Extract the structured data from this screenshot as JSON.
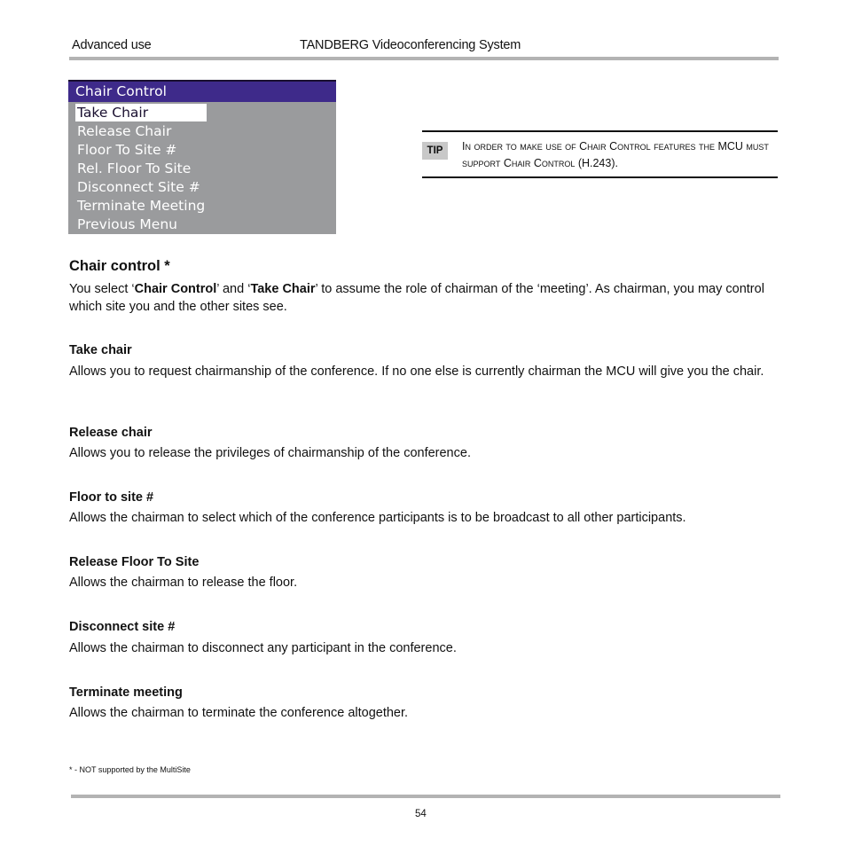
{
  "header": {
    "section": "Advanced use",
    "title": "TANDBERG Videoconferencing System"
  },
  "osd_menu": {
    "title": "Chair Control",
    "selected_index": 0,
    "items": [
      {
        "label": "Take Chair"
      },
      {
        "label": "Release Chair"
      },
      {
        "label": "Floor To Site #"
      },
      {
        "label": "Rel. Floor To Site"
      },
      {
        "label": "Disconnect Site #"
      },
      {
        "label": "Terminate Meeting"
      },
      {
        "label": "Previous Menu"
      }
    ],
    "colors": {
      "title_bg": "#3e2a8a",
      "menu_bg": "#9a9b9d",
      "selected_bg": "#ffffff"
    }
  },
  "tip": {
    "badge": "TIP",
    "text": "In order to make use of Chair Control features the MCU must support Chair Control (H.243)."
  },
  "section": {
    "heading": "Chair control *",
    "intro": {
      "p1": "You select ‘",
      "b1": "Chair Control",
      "p2": "’ and ‘",
      "b2": "Take Chair",
      "p3": "’ to assume the role of chairman of the ‘meeting’. As chairman, you may control which site you and the other sites see."
    },
    "subsections": [
      {
        "heading": "Take  chair",
        "text": "Allows you to request chairmanship of the conference. If no one else is currently chairman the MCU will give you the chair."
      },
      {
        "heading": "Release  chair",
        "text": "Allows you to release the privileges of chairmanship of the conference."
      },
      {
        "heading": "Floor to site #",
        "text": "Allows the chairman to select which of the conference participants is to be broadcast to all other participants."
      },
      {
        "heading": "Release Floor To Site",
        "text": "Allows the chairman to release the floor."
      },
      {
        "heading": "Disconnect site #",
        "text": "Allows the chairman to disconnect any participant in the conference."
      },
      {
        "heading": "Terminate  meeting",
        "text": "Allows the chairman to terminate the conference altogether."
      }
    ]
  },
  "footnote": "* - NOT supported by the MultiSite",
  "footer": {
    "page_number": "54"
  }
}
